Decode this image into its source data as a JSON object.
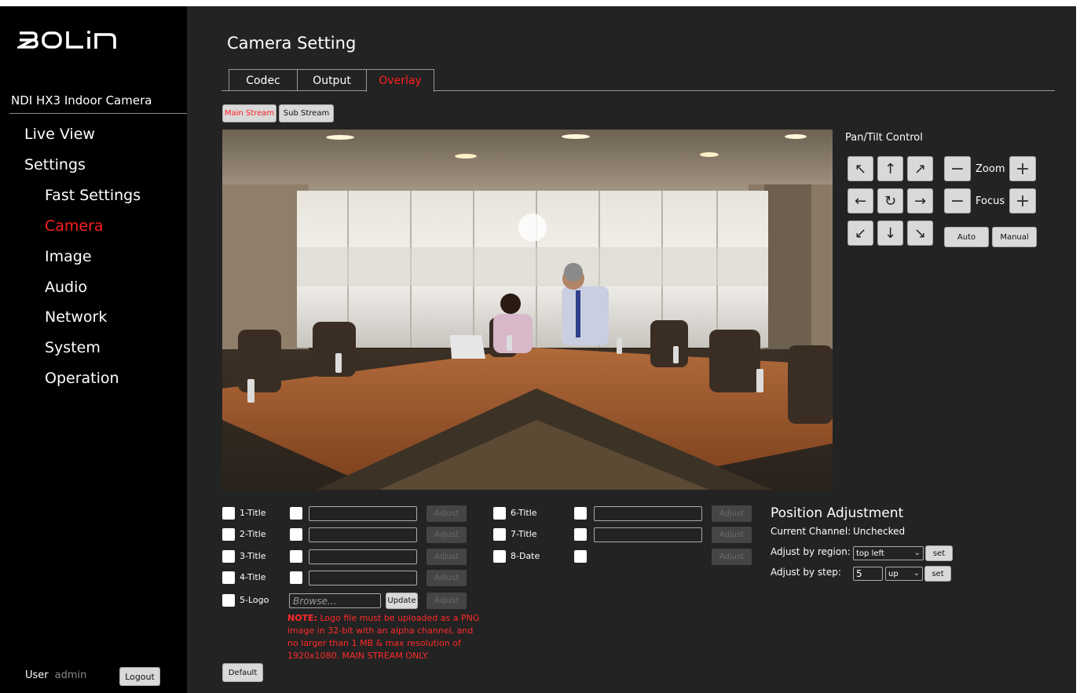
{
  "brand": {
    "logo_text": "BOLIN",
    "device_name": "NDI HX3 Indoor Camera"
  },
  "sidebar": {
    "items": [
      {
        "label": "Live View",
        "active": false
      },
      {
        "label": "Settings",
        "active": false
      },
      {
        "label": "Fast Settings",
        "active": false
      },
      {
        "label": "Camera",
        "active": true
      },
      {
        "label": "Image",
        "active": false
      },
      {
        "label": "Audio",
        "active": false
      },
      {
        "label": "Network",
        "active": false
      },
      {
        "label": "System",
        "active": false
      },
      {
        "label": "Operation",
        "active": false
      }
    ],
    "user_label": "User",
    "user_name": "admin",
    "logout_label": "Logout"
  },
  "header": {
    "title": "Camera Setting"
  },
  "tabs": [
    {
      "label": "Codec",
      "active": false
    },
    {
      "label": "Output",
      "active": false
    },
    {
      "label": "Overlay",
      "active": true
    }
  ],
  "stream_buttons": {
    "main": "Main Stream",
    "sub": "Sub Stream",
    "active": "main"
  },
  "ptz": {
    "title": "Pan/Tilt Control",
    "arrows": {
      "up_left": "↖",
      "up": "↑",
      "up_right": "↗",
      "left": "←",
      "home": "↻",
      "right": "→",
      "down_left": "↙",
      "down": "↓",
      "down_right": "↘"
    },
    "zoom_label": "Zoom",
    "focus_label": "Focus",
    "minus": "−",
    "plus": "+",
    "auto_label": "Auto",
    "manual_label": "Manual"
  },
  "overlay": {
    "left_rows": [
      {
        "label": "1-Title",
        "value": "",
        "adjust": "Adjust"
      },
      {
        "label": "2-Title",
        "value": "",
        "adjust": "Adjust"
      },
      {
        "label": "3-Title",
        "value": "",
        "adjust": "Adjust"
      },
      {
        "label": "4-Title",
        "value": "",
        "adjust": "Adjust"
      }
    ],
    "logo_row": {
      "label": "5-Logo",
      "browse_placeholder": "Browse...",
      "update_label": "Update",
      "adjust": "Adjust"
    },
    "right_rows": [
      {
        "label": "6-Title",
        "value": "",
        "adjust": "Adjust"
      },
      {
        "label": "7-Title",
        "value": "",
        "adjust": "Adjust"
      },
      {
        "label": "8-Date",
        "adjust": "Adjust"
      }
    ],
    "note_prefix": "NOTE:",
    "note_text": " Logo file must be uploaded as a PNG image in 32-bit with an alpha channel, and no larger than 1 MB & max resolution of 1920x1080. MAIN STREAM ONLY.",
    "default_label": "Default"
  },
  "position": {
    "title": "Position Adjustment",
    "current_channel_label": "Current Channel:",
    "current_channel_value": "Unchecked",
    "region_label": "Adjust by region:",
    "region_value": "top left",
    "step_label": "Adjust by step:",
    "step_value": "5",
    "direction_value": "up",
    "set_label": "set"
  },
  "colors": {
    "accent": "#ff1f1f",
    "background": "#232323",
    "sidebar": "#000000",
    "button": "#d9d9d9"
  }
}
